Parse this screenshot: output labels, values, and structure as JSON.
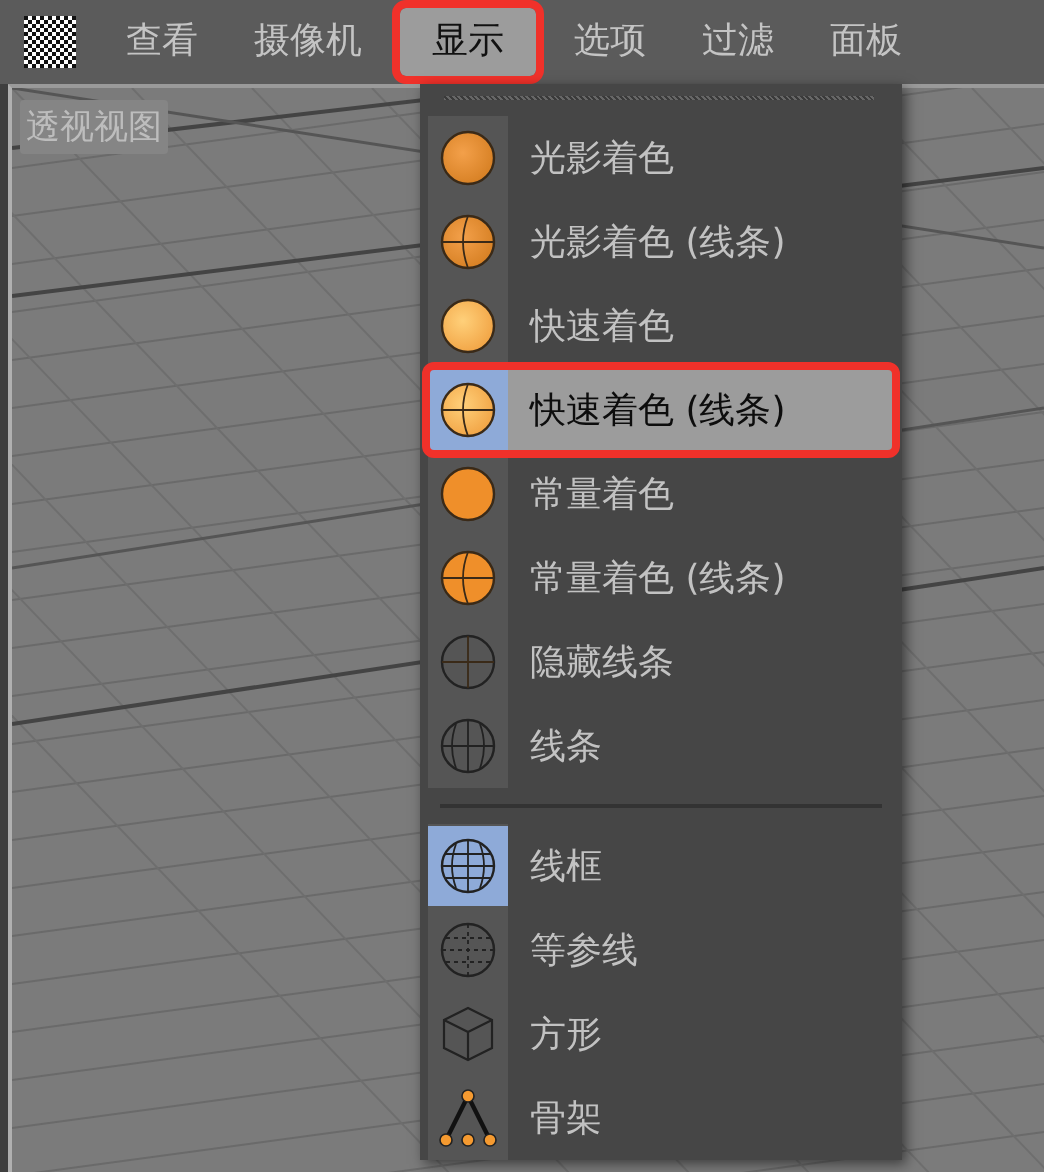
{
  "menubar": {
    "items": [
      {
        "label": "查看",
        "selected": false,
        "annotated": false
      },
      {
        "label": "摄像机",
        "selected": false,
        "annotated": false
      },
      {
        "label": "显示",
        "selected": true,
        "annotated": true
      },
      {
        "label": "选项",
        "selected": false,
        "annotated": false
      },
      {
        "label": "过滤",
        "selected": false,
        "annotated": false
      },
      {
        "label": "面板",
        "selected": false,
        "annotated": false
      }
    ]
  },
  "viewport": {
    "label": "透视视图"
  },
  "dropdown": {
    "sections": [
      {
        "items": [
          {
            "label": "光影着色",
            "kind": "shaded",
            "selected": false,
            "checked": false,
            "annotated": false
          },
          {
            "label": "光影着色 (线条)",
            "kind": "shaded-lines",
            "selected": false,
            "checked": false,
            "annotated": false
          },
          {
            "label": "快速着色",
            "kind": "quick",
            "selected": false,
            "checked": false,
            "annotated": false
          },
          {
            "label": "快速着色 (线条)",
            "kind": "quick-lines",
            "selected": true,
            "checked": true,
            "annotated": true
          },
          {
            "label": "常量着色",
            "kind": "constant",
            "selected": false,
            "checked": false,
            "annotated": false
          },
          {
            "label": "常量着色 (线条)",
            "kind": "constant-lines",
            "selected": false,
            "checked": false,
            "annotated": false
          },
          {
            "label": "隐藏线条",
            "kind": "hidden-lines",
            "selected": false,
            "checked": false,
            "annotated": false
          },
          {
            "label": "线条",
            "kind": "lines",
            "selected": false,
            "checked": false,
            "annotated": false
          }
        ]
      },
      {
        "items": [
          {
            "label": "线框",
            "kind": "wireframe",
            "selected": false,
            "checked": true,
            "annotated": false
          },
          {
            "label": "等参线",
            "kind": "isoparm",
            "selected": false,
            "checked": false,
            "annotated": false
          },
          {
            "label": "方形",
            "kind": "box",
            "selected": false,
            "checked": false,
            "annotated": false
          },
          {
            "label": "骨架",
            "kind": "skeleton",
            "selected": false,
            "checked": false,
            "annotated": false
          }
        ]
      }
    ]
  }
}
